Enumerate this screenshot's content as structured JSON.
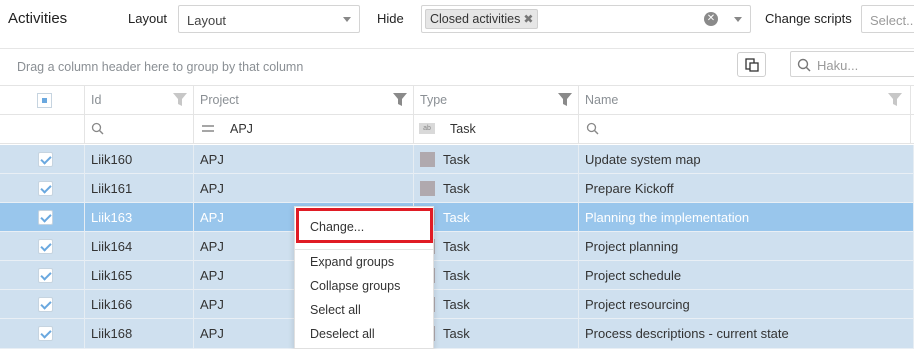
{
  "topbar": {
    "title": "Activities",
    "layout_label": "Layout",
    "layout_value": "Layout",
    "hide_label": "Hide",
    "hide_tag": "Closed activities",
    "change_scripts_label": "Change scripts",
    "change_scripts_placeholder": "Select..."
  },
  "toolbar": {
    "group_hint": "Drag a column header here to group by that column",
    "search_placeholder": "Haku..."
  },
  "columns": {
    "id": "Id",
    "project": "Project",
    "type": "Type",
    "name": "Name"
  },
  "filters": {
    "project": "APJ",
    "type": "Task"
  },
  "rows": [
    {
      "id": "Liik160",
      "project": "APJ",
      "type": "Task",
      "name": "Update system map"
    },
    {
      "id": "Liik161",
      "project": "APJ",
      "type": "Task",
      "name": "Prepare Kickoff"
    },
    {
      "id": "Liik163",
      "project": "APJ",
      "type": "Task",
      "name": "Planning the implementation"
    },
    {
      "id": "Liik164",
      "project": "APJ",
      "type": "Task",
      "name": "Project planning"
    },
    {
      "id": "Liik165",
      "project": "APJ",
      "type": "Task",
      "name": "Project schedule"
    },
    {
      "id": "Liik166",
      "project": "APJ",
      "type": "Task",
      "name": "Project resourcing"
    },
    {
      "id": "Liik168",
      "project": "APJ",
      "type": "Task",
      "name": "Process descriptions - current state"
    }
  ],
  "context_menu": {
    "change": "Change...",
    "expand": "Expand groups",
    "collapse": "Collapse groups",
    "select_all": "Select all",
    "deselect_all": "Deselect all"
  },
  "colors": {
    "row_bg": "#cfe0ef",
    "row_selected": "#99c6ec",
    "highlight": "#e01b24"
  }
}
